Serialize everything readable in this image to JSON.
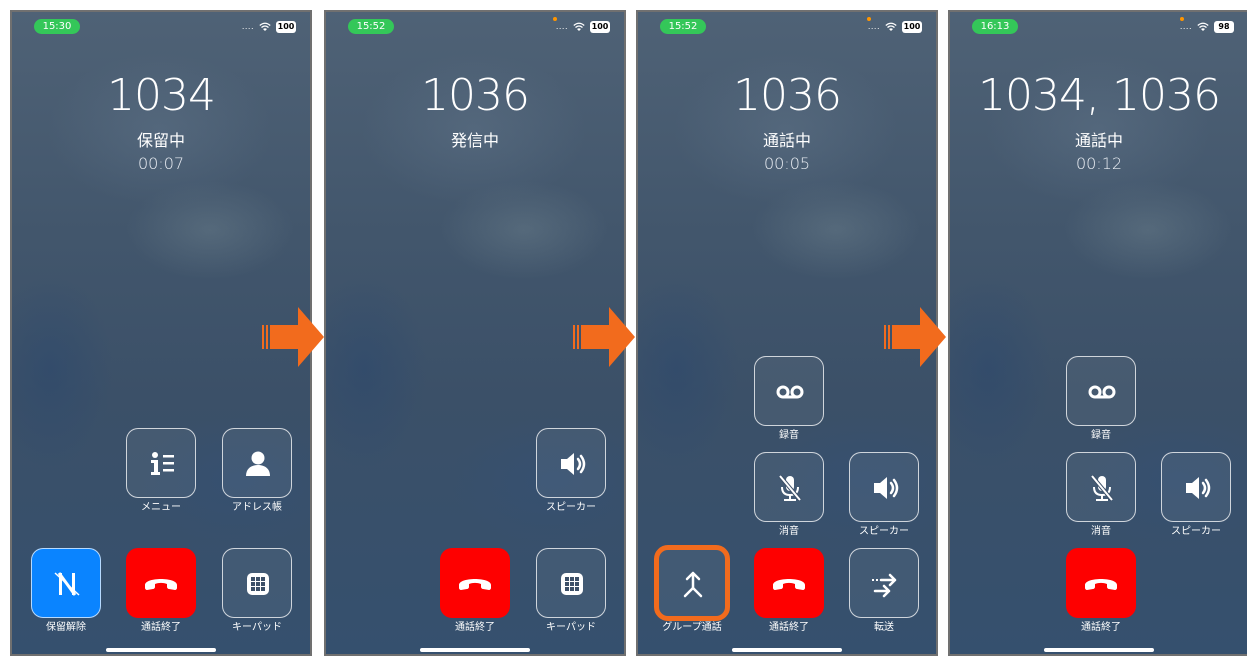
{
  "screens": [
    {
      "time": "15:30",
      "battery": "100",
      "caller": "1034",
      "status": "保留中",
      "duration": "00:07",
      "labels": {
        "menu": "メニュー",
        "contacts": "アドレス帳",
        "unhold": "保留解除",
        "end": "通話終了",
        "keypad": "キーパッド"
      }
    },
    {
      "time": "15:52",
      "battery": "100",
      "caller": "1036",
      "status": "発信中",
      "labels": {
        "speaker": "スピーカー",
        "end": "通話終了",
        "keypad": "キーパッド"
      }
    },
    {
      "time": "15:52",
      "battery": "100",
      "caller": "1036",
      "status": "通話中",
      "duration": "00:05",
      "labels": {
        "record": "録音",
        "mute": "消音",
        "speaker": "スピーカー",
        "group": "グループ通話",
        "end": "通話終了",
        "transfer": "転送"
      }
    },
    {
      "time": "16:13",
      "battery": "98",
      "caller": "1034, 1036",
      "status": "通話中",
      "duration": "00:12",
      "labels": {
        "record": "録音",
        "mute": "消音",
        "speaker": "スピーカー",
        "end": "通話終了"
      }
    }
  ],
  "colors": {
    "accent_orange": "#f26b1d",
    "end_call_red": "#fe0000",
    "hold_blue": "#0a84ff",
    "time_pill_green": "#34c759"
  },
  "icons": [
    "list-icon",
    "person-icon",
    "unhold-icon",
    "hangup-icon",
    "keypad-icon",
    "speaker-icon",
    "voicemail-icon",
    "mute-icon",
    "merge-icon",
    "transfer-icon",
    "wifi-icon",
    "right-arrow-icon"
  ]
}
